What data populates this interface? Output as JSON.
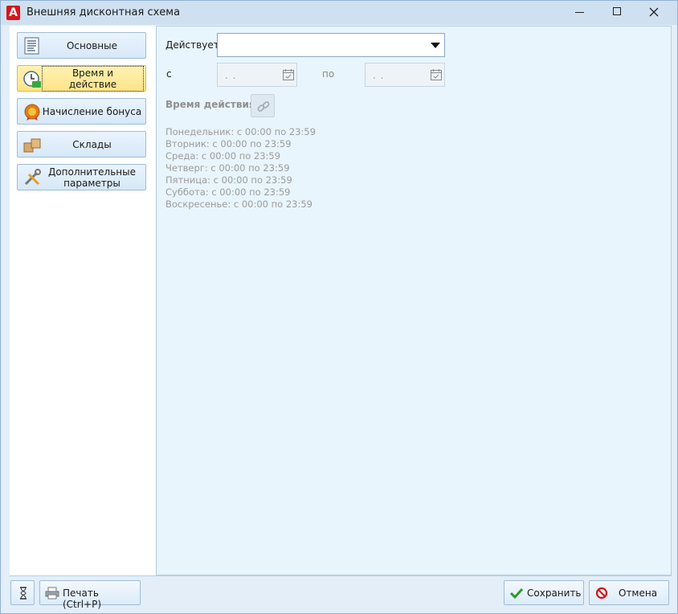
{
  "window": {
    "title": "Внешняя дисконтная схема",
    "app_icon_letter": "A",
    "accent": "#d7141a"
  },
  "nav": {
    "items": [
      {
        "label": "Основные",
        "icon": "document-list-icon",
        "active": false
      },
      {
        "label": "Время и действие",
        "icon": "clock-icon",
        "active": true
      },
      {
        "label": "Начисление бонуса",
        "icon": "bonus-badge-icon",
        "active": false
      },
      {
        "label": "Склады",
        "icon": "boxes-icon",
        "active": false
      },
      {
        "label": "Дополнительные параметры",
        "icon": "tools-icon",
        "active": false
      }
    ]
  },
  "form": {
    "active_label": "Действует",
    "active_value": "",
    "from_label": "с",
    "from_value": ". .",
    "to_label": "по",
    "to_value": ". .",
    "schedule_title": "Время действия",
    "schedule": [
      "Понедельник: с 00:00 по 23:59",
      "Вторник: с 00:00 по 23:59",
      "Среда: с 00:00 по 23:59",
      "Четверг: с 00:00 по 23:59",
      "Пятница: с 00:00 по 23:59",
      "Суббота: с 00:00 по 23:59",
      "Воскресенье: с 00:00 по 23:59"
    ]
  },
  "footer": {
    "print_label": "Печать (Ctrl+P)",
    "save_label": "Сохранить",
    "cancel_label": "Отмена"
  }
}
